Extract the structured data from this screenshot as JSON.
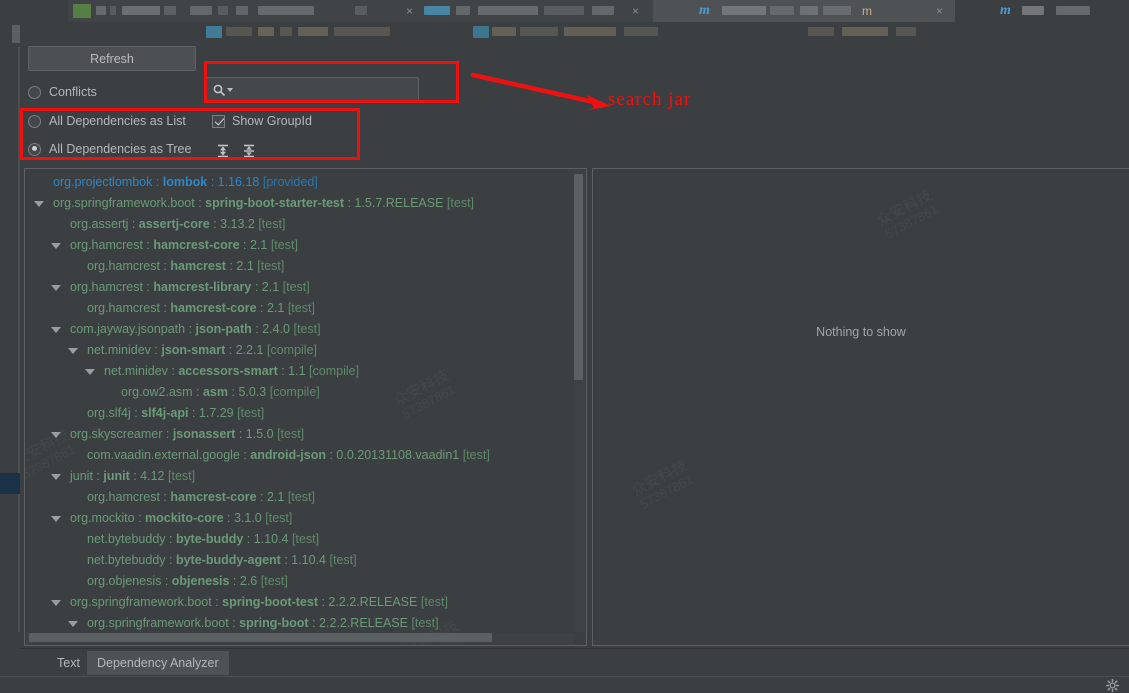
{
  "window": {
    "bottom_gear_icon": "gear-icon"
  },
  "tabstrip": {
    "maven_icon": "m",
    "maven_icon_plain": "m",
    "close_label": "×"
  },
  "toolbar": {
    "refresh_label": "Refresh",
    "conflicts_label": "Conflicts",
    "list_label": "All Dependencies as List",
    "tree_label": "All Dependencies as Tree",
    "show_groupid_label": "Show GroupId",
    "search_value": "",
    "search_placeholder": "",
    "search_icon": "search-icon",
    "expand_all_icon": "expand-all-icon",
    "collapse_all_icon": "collapse-all-icon",
    "conflicts_checked": false,
    "list_checked": false,
    "tree_checked": true,
    "show_groupid_checked": true
  },
  "annotations": {
    "search_jar_label": "search jar"
  },
  "tree": {
    "rows": [
      {
        "indent": 0,
        "twisty": false,
        "color": "blue",
        "group": "org.projectlombok",
        "artifact": "lombok",
        "version": "1.16.18",
        "scope": "[provided]"
      },
      {
        "indent": 0,
        "twisty": true,
        "color": "green",
        "group": "org.springframework.boot",
        "artifact": "spring-boot-starter-test",
        "version": "1.5.7.RELEASE",
        "scope": "[test]"
      },
      {
        "indent": 1,
        "twisty": false,
        "color": "green",
        "group": "org.assertj",
        "artifact": "assertj-core",
        "version": "3.13.2",
        "scope": "[test]"
      },
      {
        "indent": 1,
        "twisty": true,
        "color": "green",
        "group": "org.hamcrest",
        "artifact": "hamcrest-core",
        "version": "2.1",
        "scope": "[test]"
      },
      {
        "indent": 2,
        "twisty": false,
        "color": "green",
        "group": "org.hamcrest",
        "artifact": "hamcrest",
        "version": "2.1",
        "scope": "[test]"
      },
      {
        "indent": 1,
        "twisty": true,
        "color": "green",
        "group": "org.hamcrest",
        "artifact": "hamcrest-library",
        "version": "2.1",
        "scope": "[test]"
      },
      {
        "indent": 2,
        "twisty": false,
        "color": "green",
        "group": "org.hamcrest",
        "artifact": "hamcrest-core",
        "version": "2.1",
        "scope": "[test]"
      },
      {
        "indent": 1,
        "twisty": true,
        "color": "green",
        "group": "com.jayway.jsonpath",
        "artifact": "json-path",
        "version": "2.4.0",
        "scope": "[test]"
      },
      {
        "indent": 2,
        "twisty": true,
        "color": "green",
        "group": "net.minidev",
        "artifact": "json-smart",
        "version": "2.2.1",
        "scope": "[compile]"
      },
      {
        "indent": 3,
        "twisty": true,
        "color": "green",
        "group": "net.minidev",
        "artifact": "accessors-smart",
        "version": "1.1",
        "scope": "[compile]"
      },
      {
        "indent": 4,
        "twisty": false,
        "color": "green",
        "group": "org.ow2.asm",
        "artifact": "asm",
        "version": "5.0.3",
        "scope": "[compile]"
      },
      {
        "indent": 2,
        "twisty": false,
        "color": "green",
        "group": "org.slf4j",
        "artifact": "slf4j-api",
        "version": "1.7.29",
        "scope": "[test]"
      },
      {
        "indent": 1,
        "twisty": true,
        "color": "green",
        "group": "org.skyscreamer",
        "artifact": "jsonassert",
        "version": "1.5.0",
        "scope": "[test]"
      },
      {
        "indent": 2,
        "twisty": false,
        "color": "green",
        "group": "com.vaadin.external.google",
        "artifact": "android-json",
        "version": "0.0.20131108.vaadin1",
        "scope": "[test]"
      },
      {
        "indent": 1,
        "twisty": true,
        "color": "green",
        "group": "junit",
        "artifact": "junit",
        "version": "4.12",
        "scope": "[test]"
      },
      {
        "indent": 2,
        "twisty": false,
        "color": "green",
        "group": "org.hamcrest",
        "artifact": "hamcrest-core",
        "version": "2.1",
        "scope": "[test]"
      },
      {
        "indent": 1,
        "twisty": true,
        "color": "green",
        "group": "org.mockito",
        "artifact": "mockito-core",
        "version": "3.1.0",
        "scope": "[test]"
      },
      {
        "indent": 2,
        "twisty": false,
        "color": "green",
        "group": "net.bytebuddy",
        "artifact": "byte-buddy",
        "version": "1.10.4",
        "scope": "[test]"
      },
      {
        "indent": 2,
        "twisty": false,
        "color": "green",
        "group": "net.bytebuddy",
        "artifact": "byte-buddy-agent",
        "version": "1.10.4",
        "scope": "[test]"
      },
      {
        "indent": 2,
        "twisty": false,
        "color": "green",
        "group": "org.objenesis",
        "artifact": "objenesis",
        "version": "2.6",
        "scope": "[test]"
      },
      {
        "indent": 1,
        "twisty": true,
        "color": "green",
        "group": "org.springframework.boot",
        "artifact": "spring-boot-test",
        "version": "2.2.2.RELEASE",
        "scope": "[test]"
      },
      {
        "indent": 2,
        "twisty": true,
        "color": "green",
        "group": "org.springframework.boot",
        "artifact": "spring-boot",
        "version": "2.2.2.RELEASE",
        "scope": "[test]"
      }
    ],
    "separator": " : "
  },
  "detail": {
    "empty_message": "Nothing to show"
  },
  "bottom_tabs": [
    {
      "label": "Text",
      "active": false
    },
    {
      "label": "Dependency Analyzer",
      "active": true
    }
  ],
  "watermark": {
    "line1": "众安科技",
    "line2": "57387861"
  },
  "colors": {
    "background": "#3c3f41",
    "panel_border": "#5a6064",
    "green_text": "#6a9a78",
    "blue_text": "#2e86c5",
    "annotation_red": "#ee1111",
    "tab_accent": "#3d9ac4"
  }
}
